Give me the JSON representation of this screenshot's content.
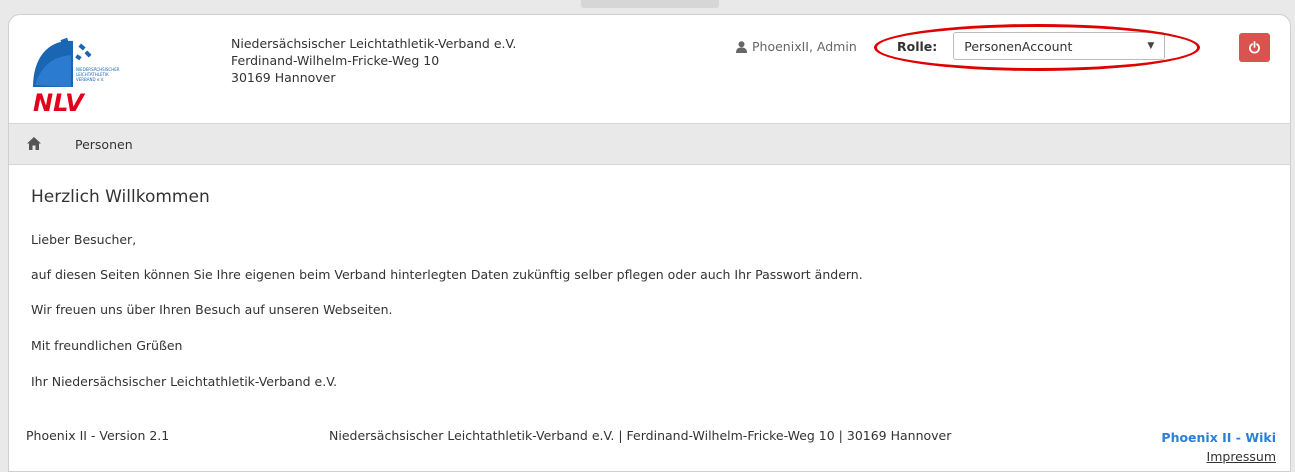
{
  "header": {
    "org_lines": [
      "Niedersächsischer Leichtathletik-Verband e.V.",
      "Ferdinand-Wilhelm-Fricke-Weg 10",
      "30169 Hannover"
    ],
    "logo": {
      "text": "NLV",
      "small_text": "NIEDERSÄCHSISCHER LEICHTATHLETIK VERBAND e.V."
    },
    "user": {
      "icon": "user-icon",
      "name": "PhoenixII, Admin"
    },
    "role": {
      "label": "Rolle:",
      "selected": "PersonenAccount"
    },
    "logout": {
      "icon": "power-icon",
      "color": "#d9534f"
    },
    "highlight_color": "#e00000"
  },
  "nav": {
    "home_icon": "home-icon",
    "items": [
      {
        "label": "Personen"
      }
    ]
  },
  "content": {
    "title": "Herzlich Willkommen",
    "paragraphs": [
      "Lieber Besucher,",
      "auf diesen Seiten können Sie Ihre eigenen beim Verband hinterlegten Daten zukünftig selber pflegen oder auch Ihr Passwort ändern.",
      "Wir freuen uns über Ihren Besuch auf unseren Webseiten.",
      "Mit freundlichen Grüßen",
      "Ihr Niedersächsischer Leichtathletik-Verband e.V."
    ]
  },
  "footer": {
    "version": "Phoenix II - Version 2.1",
    "address": "Niedersächsischer Leichtathletik-Verband e.V. | Ferdinand-Wilhelm-Fricke-Weg 10 | 30169 Hannover",
    "wiki_link": "Phoenix II - Wiki",
    "impressum_link": "Impressum",
    "link_color": "#2a7fd6"
  }
}
